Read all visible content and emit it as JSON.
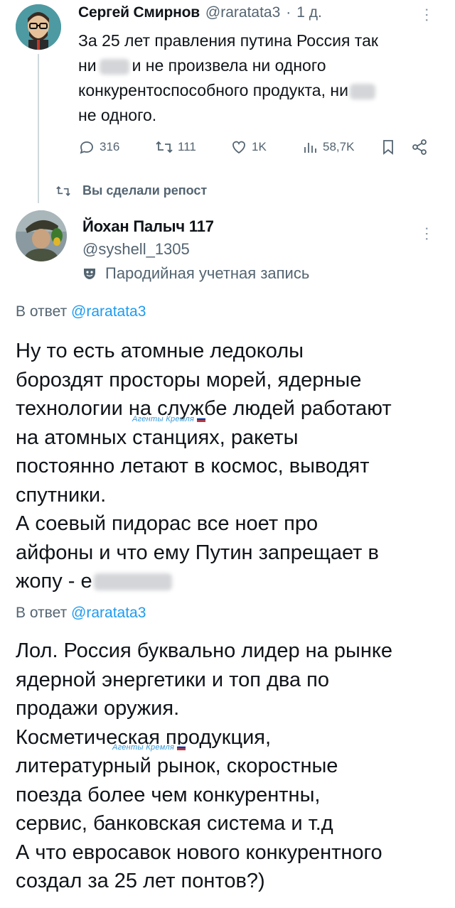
{
  "first_tweet": {
    "display_name": "Сергей Смирнов",
    "handle": "@raratata3",
    "separator": "·",
    "time": "1 д.",
    "text_lines": [
      "За 25 лет правления путина Россия так",
      "ни",
      "и не произвела ни одного",
      "конкурентоспособного продукта, ни",
      "не одного."
    ],
    "stats": {
      "replies": "316",
      "reposts": "111",
      "likes": "1K",
      "views": "58,7K"
    }
  },
  "repost_notice": "Вы сделали репост",
  "second_tweet": {
    "display_name": "Йохан Палыч 117",
    "handle": "@syshell_1305",
    "parody_label": "Пародийная учетная запись"
  },
  "reply_1": {
    "prefix": "В ответ",
    "mention": "@raratata3",
    "lines": [
      "Ну то есть атомные ледоколы",
      "бороздят просторы морей, ядерные",
      "технологии на службе людей работают",
      "на атомных станциях, ракеты",
      "постоянно летают в космос, выводят",
      "спутники.",
      "А соевый пидорас все ноет про",
      "айфоны и что ему Путин запрещает в",
      "жопу - е"
    ]
  },
  "reply_2": {
    "prefix": "В ответ",
    "mention": "@raratata3",
    "lines": [
      "Лол. Россия буквально лидер на рынке",
      "ядерной энергетики и топ два по",
      "продажи оружия.",
      "Косметическая продукция,",
      "литературный рынок, скоростные",
      "поезда более чем конкурентны,",
      "сервис, банковская система и т.д",
      "А что евросавок нового конкурентного",
      "создал за 25 лет понтов?)"
    ]
  },
  "watermark": "Агенты Кремля",
  "colors": {
    "accent": "#1d9bf0",
    "secondary": "#536471",
    "text": "#0f1419"
  }
}
